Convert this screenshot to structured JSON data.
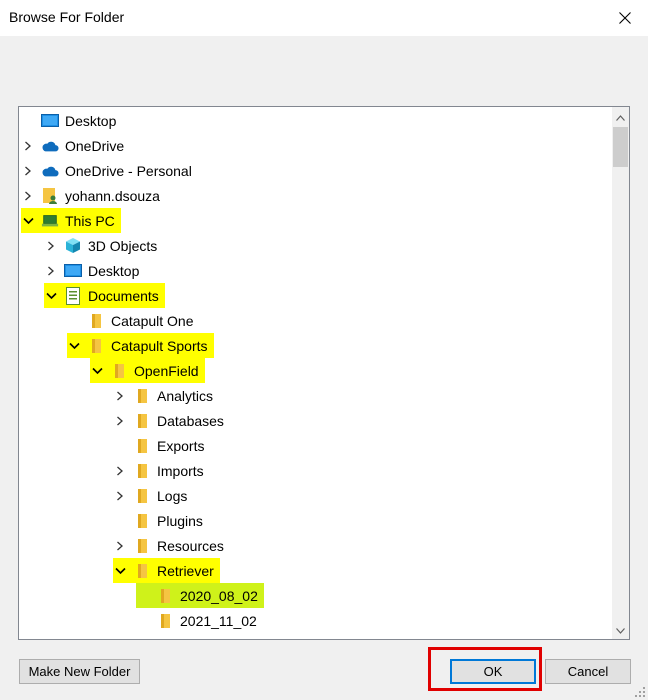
{
  "window": {
    "title": "Browse For Folder"
  },
  "tree": {
    "items": [
      {
        "label": "Desktop",
        "icon": "desktop-icon",
        "depth": 0,
        "expander": "none",
        "highlight": ""
      },
      {
        "label": "OneDrive",
        "icon": "cloud-icon",
        "depth": 0,
        "expander": "collapsed",
        "highlight": ""
      },
      {
        "label": "OneDrive - Personal",
        "icon": "cloud-icon",
        "depth": 0,
        "expander": "collapsed",
        "highlight": ""
      },
      {
        "label": "yohann.dsouza",
        "icon": "user-folder-icon",
        "depth": 0,
        "expander": "collapsed",
        "highlight": ""
      },
      {
        "label": "This PC",
        "icon": "pc-icon",
        "depth": 0,
        "expander": "expanded",
        "highlight": "yellow"
      },
      {
        "label": "3D Objects",
        "icon": "cube-icon",
        "depth": 1,
        "expander": "collapsed",
        "highlight": ""
      },
      {
        "label": "Desktop",
        "icon": "desktop-icon",
        "depth": 1,
        "expander": "collapsed",
        "highlight": ""
      },
      {
        "label": "Documents",
        "icon": "document-icon",
        "depth": 1,
        "expander": "expanded",
        "highlight": "yellow"
      },
      {
        "label": "Catapult One",
        "icon": "folder-icon",
        "depth": 2,
        "expander": "none",
        "highlight": ""
      },
      {
        "label": "Catapult Sports",
        "icon": "folder-icon",
        "depth": 2,
        "expander": "expanded",
        "highlight": "yellow"
      },
      {
        "label": "OpenField",
        "icon": "folder-icon",
        "depth": 3,
        "expander": "expanded",
        "highlight": "yellow"
      },
      {
        "label": "Analytics",
        "icon": "folder-icon",
        "depth": 4,
        "expander": "collapsed",
        "highlight": ""
      },
      {
        "label": "Databases",
        "icon": "folder-icon",
        "depth": 4,
        "expander": "collapsed",
        "highlight": ""
      },
      {
        "label": "Exports",
        "icon": "folder-icon",
        "depth": 4,
        "expander": "none",
        "highlight": ""
      },
      {
        "label": "Imports",
        "icon": "folder-icon",
        "depth": 4,
        "expander": "collapsed",
        "highlight": ""
      },
      {
        "label": "Logs",
        "icon": "folder-icon",
        "depth": 4,
        "expander": "collapsed",
        "highlight": ""
      },
      {
        "label": "Plugins",
        "icon": "folder-icon",
        "depth": 4,
        "expander": "none",
        "highlight": ""
      },
      {
        "label": "Resources",
        "icon": "folder-icon",
        "depth": 4,
        "expander": "collapsed",
        "highlight": ""
      },
      {
        "label": "Retriever",
        "icon": "folder-icon",
        "depth": 4,
        "expander": "expanded",
        "highlight": "yellow"
      },
      {
        "label": "2020_08_02",
        "icon": "folder-icon",
        "depth": 5,
        "expander": "none",
        "highlight": "selected"
      },
      {
        "label": "2021_11_02",
        "icon": "folder-icon",
        "depth": 5,
        "expander": "none",
        "highlight": ""
      }
    ]
  },
  "buttons": {
    "make_new_folder": "Make New Folder",
    "ok": "OK",
    "cancel": "Cancel"
  },
  "colors": {
    "highlight": "#ffff00",
    "selected_highlight": "#cff21a",
    "annotation_box": "#e00000",
    "folder": "#f5c542"
  }
}
